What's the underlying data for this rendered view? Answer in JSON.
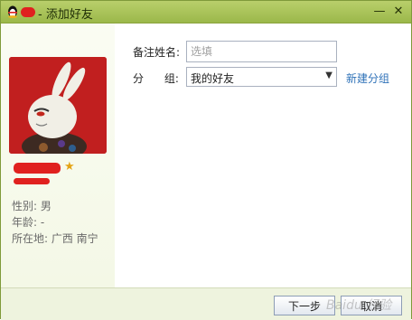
{
  "window": {
    "title": " - 添加好友"
  },
  "profile": {
    "gender_line": "性别: 男",
    "age_line": "年龄:  -",
    "location_line": "所在地: 广西  南宁"
  },
  "form": {
    "remark_label": "备注姓名:",
    "remark_placeholder": "选填",
    "group_label": "分      组:",
    "group_value": "我的好友",
    "new_group_link": "新建分组"
  },
  "footer": {
    "next_label": "下一步",
    "cancel_label": "取消"
  },
  "icons": {
    "app": "qq-penguin-icon",
    "minimize": "minimize-icon",
    "close": "close-icon",
    "favorite": "star-icon",
    "dropdown": "chevron-down-icon"
  },
  "colors": {
    "titlebar": "#9bb84a",
    "link": "#2f72b8",
    "avatar_bg": "#c11f1f"
  },
  "watermark": {
    "text": "Baidu 经验"
  }
}
